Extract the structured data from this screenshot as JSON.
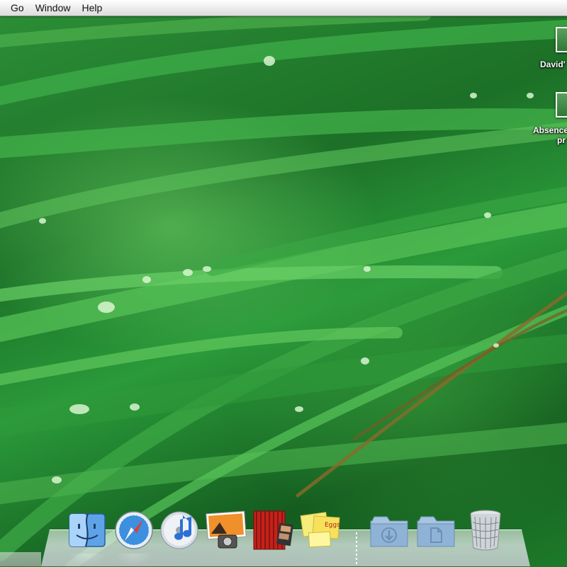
{
  "menubar": {
    "items": [
      {
        "label": "Go"
      },
      {
        "label": "Window"
      },
      {
        "label": "Help"
      }
    ]
  },
  "desktop": {
    "icons": [
      {
        "label": "David'"
      },
      {
        "label_line1": "Absence",
        "label_line2": "pr"
      }
    ]
  },
  "dock": {
    "apps": [
      {
        "icon": "finder-icon"
      },
      {
        "icon": "safari-icon"
      },
      {
        "icon": "itunes-icon"
      },
      {
        "icon": "iphoto-icon"
      },
      {
        "icon": "front-row-icon"
      },
      {
        "icon": "stickies-icon",
        "note_lines": [
          "Eggs"
        ]
      },
      {
        "icon": "downloads-folder-icon"
      },
      {
        "icon": "documents-folder-icon"
      },
      {
        "icon": "trash-icon"
      }
    ]
  },
  "colors": {
    "menubar": "#e9e9e9",
    "wallpaper_green": "#1f7a2c",
    "sticky_yellow": "#f7e15a",
    "folder_blue": "#8fb3d6"
  }
}
